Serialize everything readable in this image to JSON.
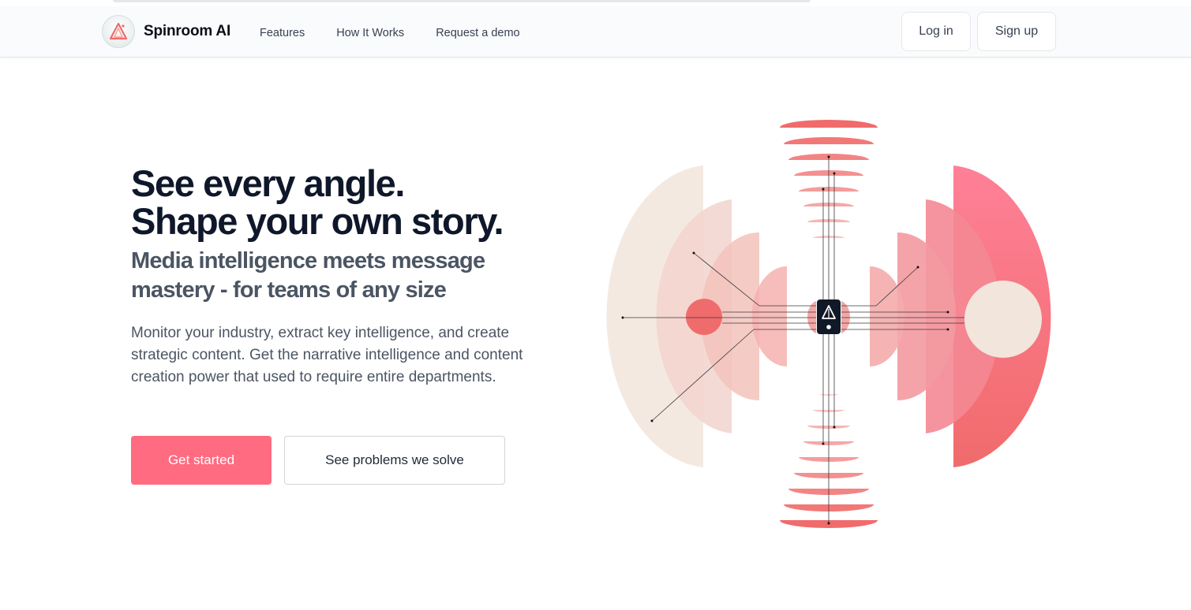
{
  "nav": {
    "brand_name": "Spinroom AI",
    "links": [
      "Features",
      "How It Works",
      "Request a demo"
    ],
    "login_label": "Log in",
    "signup_label": "Sign up"
  },
  "hero": {
    "headline_line1": "See every angle.",
    "headline_line2": "Shape your own story.",
    "subhead_line1": "Media intelligence meets message",
    "subhead_line2": "mastery - for teams of any size",
    "description": "Monitor your industry, extract key intelligence, and create strategic content. Get the narrative intelligence and content creation power that used to require entire departments.",
    "cta_primary": "Get started",
    "cta_secondary": "See problems we solve"
  },
  "colors": {
    "accent": "#ff6b81",
    "headline": "#0f172a",
    "subhead": "#4b5563",
    "coral": "#f06b6b",
    "cream": "#f2e5dc"
  },
  "icons": {
    "brand": "spinroom-triangle-logo-icon",
    "center": "spinroom-triangle-mark-icon"
  }
}
